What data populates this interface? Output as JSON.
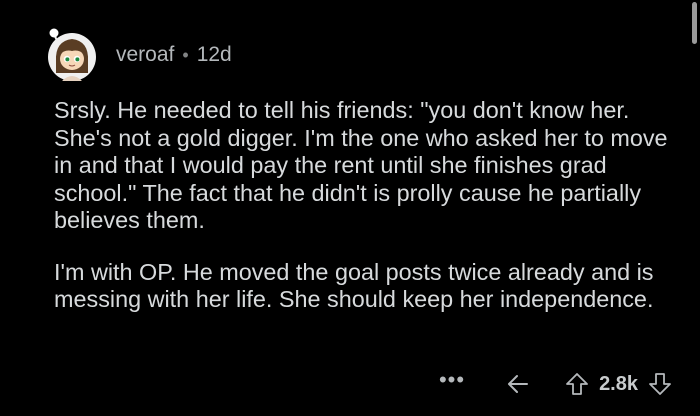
{
  "comment": {
    "username": "veroaf",
    "separator": "•",
    "age": "12d",
    "paragraphs": [
      "Srsly. He needed to tell his friends: \"you don't know her. She's not a gold digger. I'm the one who asked her to move in and that I would pay the rent until she finishes grad school.\" The fact that he didn't is prolly cause he partially believes them.",
      "I'm with OP. He moved the goal posts twice already and is messing with her life. She should keep her independence."
    ],
    "actions": {
      "more_label": "•••",
      "score": "2.8k"
    }
  },
  "icons": {
    "avatar": "avatar",
    "reply": "reply-icon",
    "upvote": "upvote-icon",
    "downvote": "downvote-icon"
  },
  "colors": {
    "background": "#000000",
    "text": "#d7dadc",
    "muted": "#b4b8bb"
  }
}
